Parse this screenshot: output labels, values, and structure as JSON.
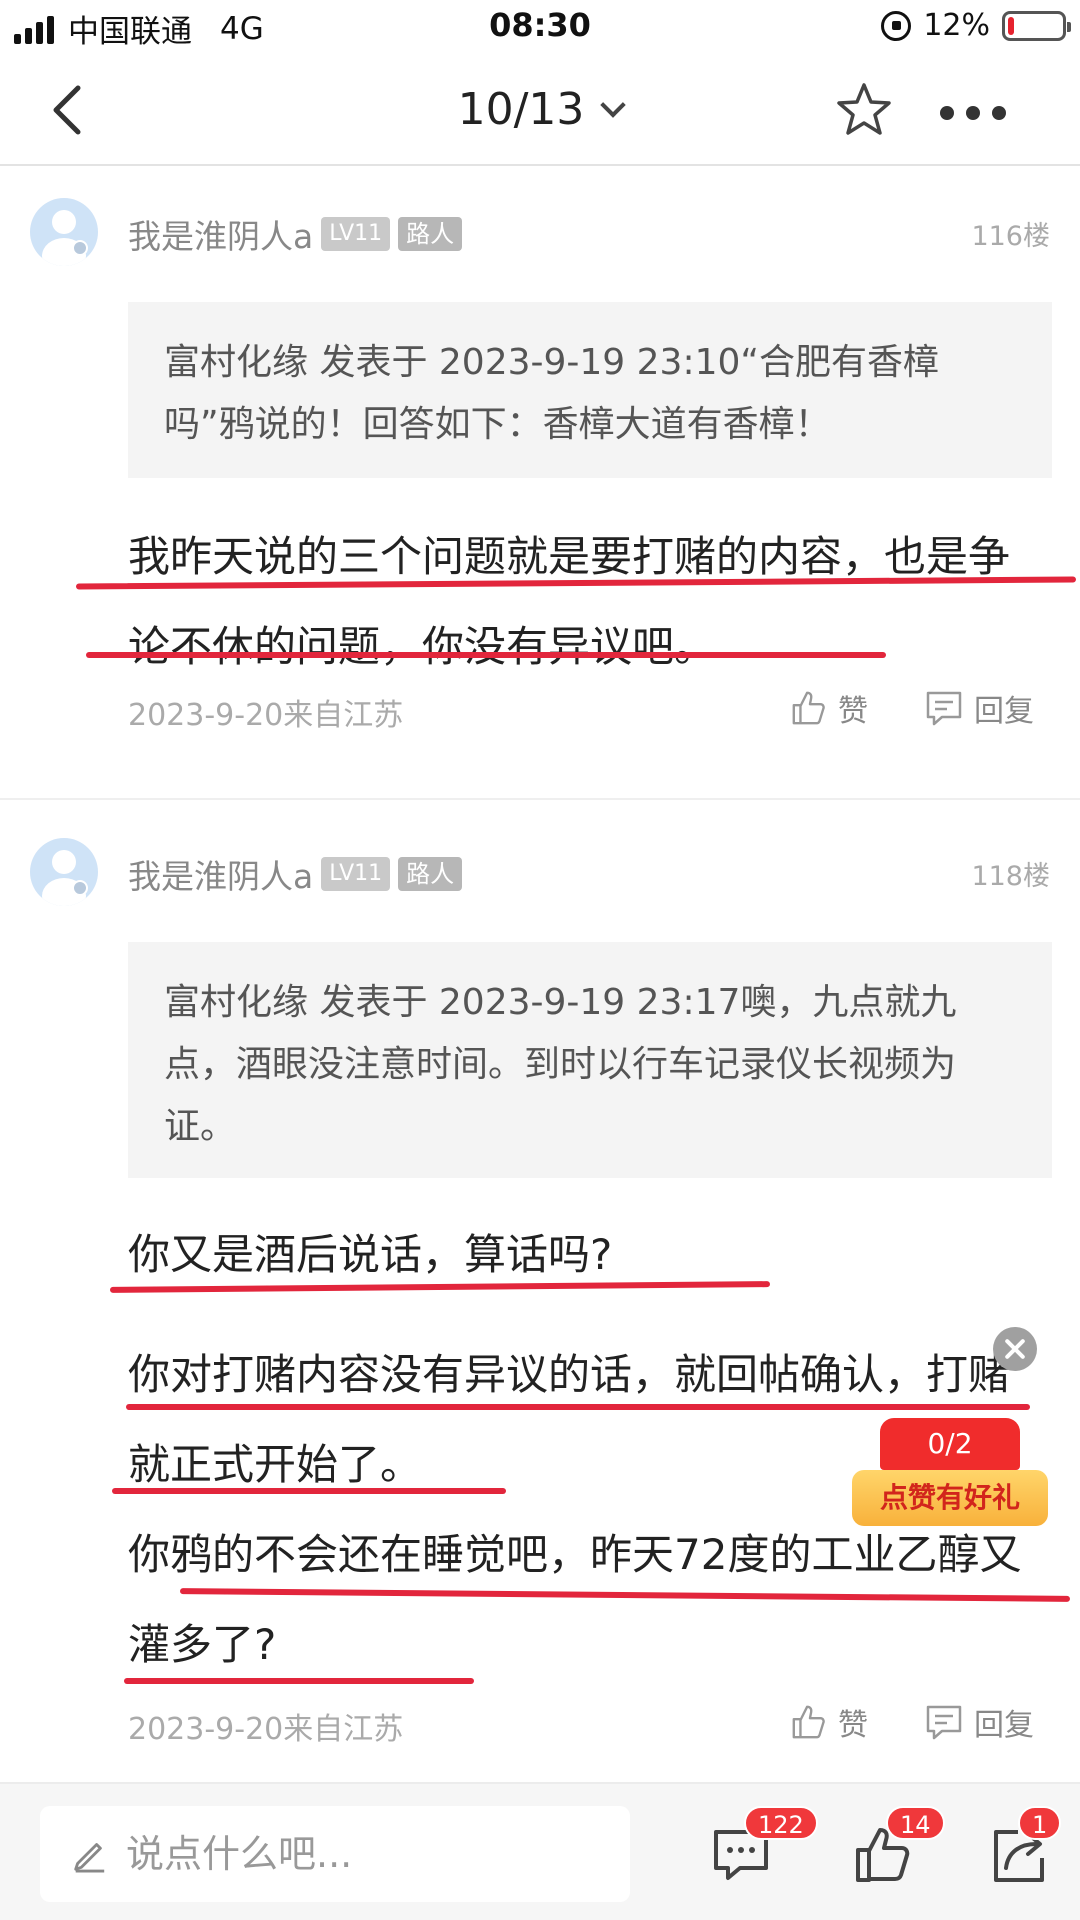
{
  "status_bar": {
    "carrier": "中国联通",
    "network": "4G",
    "time": "08:30",
    "battery": "12%",
    "battery_level": 0.12
  },
  "nav": {
    "page_indicator": "10/13"
  },
  "posts": [
    {
      "username": "我是淮阴人a",
      "level": "LV11",
      "role": "路人",
      "floor": "116楼",
      "quote": "富村化缘 发表于 2023-9-19 23:10“合肥有香樟吗”鸦说的！回答如下：香樟大道有香樟！",
      "paragraphs": [
        "我昨天说的三个问题就是要打赌的内容，也是争论不休的问题，你没有异议吧。"
      ],
      "date": "2023-9-20来自江苏",
      "like_label": "赞",
      "reply_label": "回复"
    },
    {
      "username": "我是淮阴人a",
      "level": "LV11",
      "role": "路人",
      "floor": "118楼",
      "quote": "富村化缘 发表于 2023-9-19 23:17噢，九点就九点，酒眼没注意时间。到时以行车记录仪长视频为证。",
      "paragraphs": [
        "你又是酒后说话，算话吗?",
        "你对打赌内容没有异议的话，就回帖确认，打赌就正式开始了。",
        "你鸦的不会还在睡觉吧，昨天72度的工业乙醇又灌多了?"
      ],
      "date": "2023-9-20来自江苏",
      "like_label": "赞",
      "reply_label": "回复"
    }
  ],
  "like_gift": {
    "count": "0/2",
    "label": "点赞有好礼"
  },
  "bottom_bar": {
    "placeholder": "说点什么吧...",
    "comments_count": "122",
    "likes_count": "14",
    "share_count": "1"
  },
  "colors": {
    "underline": "#e2263c",
    "badge_red": "#f0383b"
  }
}
